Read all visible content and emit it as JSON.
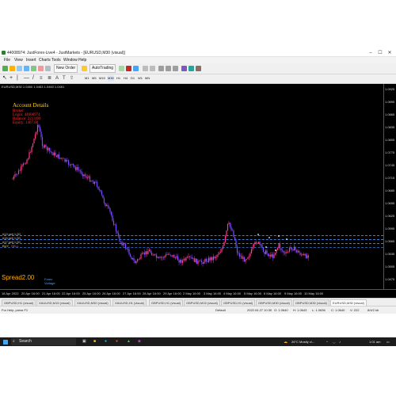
{
  "window": {
    "title": "44008974: JustForex-Live4 - JustMarkets - [EURUSD,M30 (visual)]",
    "minimize": "–",
    "maximize": "☐",
    "close": "✕"
  },
  "menu": [
    "File",
    "View",
    "Insert",
    "Charts",
    "Tools",
    "Window",
    "Help"
  ],
  "toolbar": {
    "new_order": "New Order",
    "auto_trading": "AutoTrading",
    "timeframes": [
      "M1",
      "M5",
      "M15",
      "M30",
      "H1",
      "H4",
      "D1",
      "W1",
      "MN"
    ]
  },
  "chart": {
    "symbol_header": "EURUSD,M30  1.0460 1.0463 1.0460 1.0461",
    "account": {
      "heading": "Account Details",
      "name": "Broker",
      "login": "Login: 44008974  ",
      "balance": "Balance: 2213.00",
      "equity": "Equity: 1467.80"
    },
    "spread": "Spread2.00",
    "spread_sub": "Forex\nVorlage",
    "level_labels": [
      "#13 sell 1.00",
      "#15 sell 1.00",
      "#17 sell 1.00",
      "BUY",
      "SELL"
    ],
    "price_labels": [
      "1.0925",
      "1.0895",
      "1.0865",
      "1.0835",
      "1.0805",
      "1.0775",
      "1.0745",
      "1.0715",
      "1.0685",
      "1.0655",
      "1.0625",
      "1.0595",
      "1.0565",
      "1.0535",
      "1.0505",
      "1.0475"
    ],
    "time_labels": [
      "18 Apr 2022",
      "20 Apr 16:00",
      "21 Apr 16:00",
      "22 Apr 16:00",
      "25 Apr 16:00",
      "26 Apr 16:00",
      "27 Apr 16:00",
      "28 Apr 16:00",
      "29 Apr 16:00",
      "2 May 16:00",
      "3 May 16:00",
      "4 May 16:00",
      "5 May 16:00",
      "6 May 16:00",
      "9 May 16:00",
      "10 May 16:00"
    ],
    "colors": {
      "background": "#000000",
      "bull": "#ff3a8c",
      "bear": "#7a4cff",
      "account_text": "#ffd21f",
      "level_line": "#3b7fd6"
    }
  },
  "tabs": [
    "GBPUSD,H1 (visual)",
    "XAUUSD,M15 (visual)",
    "XAUUSD,M30 (visual)",
    "XAUUSD,H1 (visual)",
    "GBPUSD,H1 (visual)",
    "GBPUSD,M15 (visual)",
    "GBPUSD,H1 (visual)",
    "GBPUSD,M30 (visual)",
    "GBPUSD,M30 (visual)",
    "EURUSD,M30 (visual)"
  ],
  "status": {
    "help": "For Help, press F1",
    "profile": "Default",
    "datetime": "2022.04.27 10:30",
    "o": "O: 1.0640",
    "h": "H: 1.0643",
    "l": "L: 1.0636",
    "c": "C: 1.0640",
    "v": "V: 222",
    "traffic": "8/4/2 kb"
  },
  "taskbar": {
    "search": "Search",
    "weather": "26°C  Mostly cl...",
    "time": "1:01 am"
  }
}
